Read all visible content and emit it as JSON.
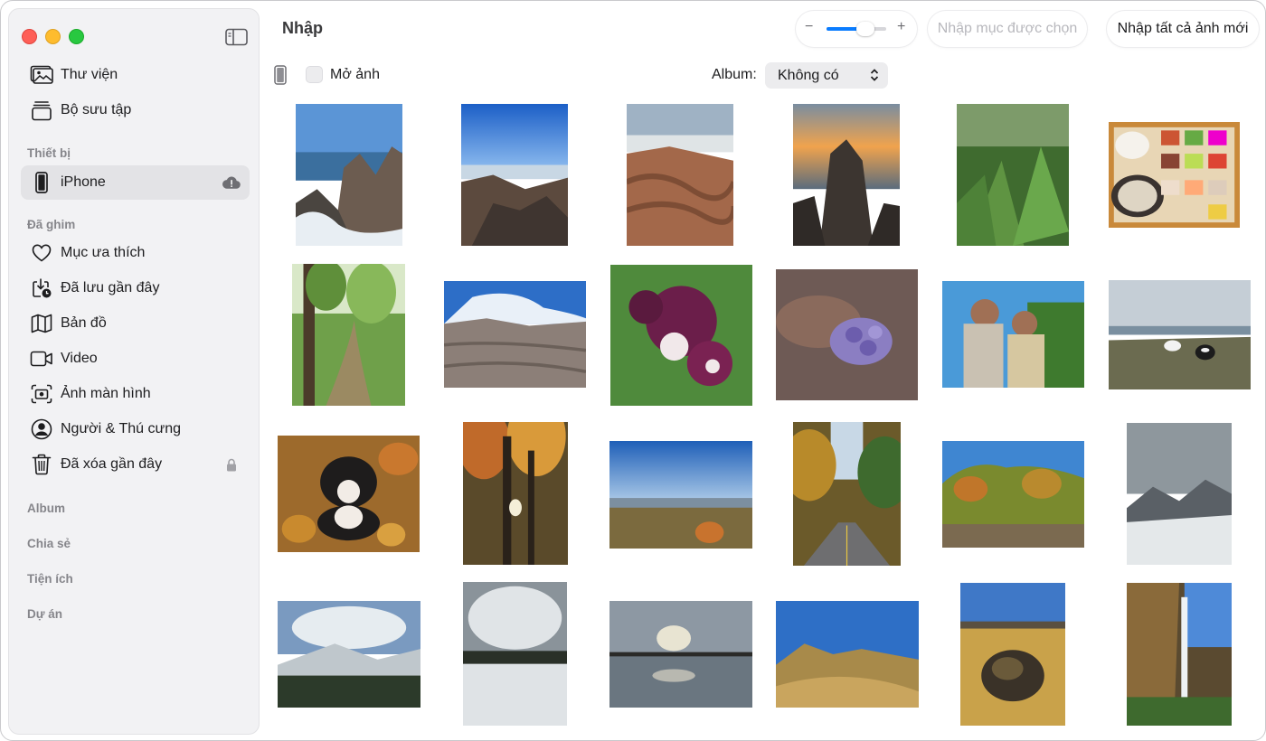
{
  "window": {
    "title": "Nhập"
  },
  "sidebar": {
    "library": [
      {
        "label": "Thư viện",
        "icon": "photos-library-icon"
      },
      {
        "label": "Bộ sưu tập",
        "icon": "collections-stack-icon"
      }
    ],
    "devices_header": "Thiết bị",
    "device": {
      "label": "iPhone",
      "icon": "iphone-icon",
      "status_icon": "cloud-alert-icon",
      "selected": true
    },
    "pinned_header": "Đã ghim",
    "pinned": [
      {
        "label": "Mục ưa thích",
        "icon": "heart-icon"
      },
      {
        "label": "Đã lưu gần đây",
        "icon": "download-clock-icon"
      },
      {
        "label": "Bản đồ",
        "icon": "map-icon"
      },
      {
        "label": "Video",
        "icon": "video-camera-icon"
      },
      {
        "label": "Ảnh màn hình",
        "icon": "screenshot-icon"
      },
      {
        "label": "Người & Thú cưng",
        "icon": "person-circle-icon"
      },
      {
        "label": "Đã xóa gần đây",
        "icon": "trash-icon",
        "trailing_icon": "lock-icon"
      }
    ],
    "sections": [
      "Album",
      "Chia sẻ",
      "Tiện ích",
      "Dự án"
    ]
  },
  "toolbar": {
    "zoom_minus": "−",
    "zoom_plus": "+",
    "zoom_level": 0.65,
    "import_selected": "Nhập mục được chọn",
    "import_all": "Nhập tất cả ảnh mới"
  },
  "subbar": {
    "open_photos_label": "Mở ảnh",
    "open_photos_checked": false,
    "album_label": "Album:",
    "album_value": "Không có"
  },
  "colors": {
    "accent": "#0a7cff",
    "sidebar_bg": "#f2f2f4",
    "selected_bg": "#e3e3e6"
  },
  "photos": [
    "coastal-rocks-waves",
    "tide-pool-rocks",
    "red-rock-coast",
    "sunset-sea-stack",
    "fern-forest",
    "korean-meal-tray",
    "forest-trail-tree",
    "desert-badlands",
    "purple-columbine-flower",
    "purple-bud-flowers",
    "two-friends-selfie",
    "two-dogs-coast",
    "dog-in-leaves",
    "autumn-forest-canopy",
    "valley-vista-autumn",
    "autumn-road",
    "autumn-hills-lake",
    "snowy-mountain-cloudy",
    "snowy-mountain-forest",
    "snowy-field-clouds",
    "lake-sunset-clouds",
    "golden-hills-blue-sky",
    "moss-crater-hills",
    "waterfall-cliff"
  ]
}
